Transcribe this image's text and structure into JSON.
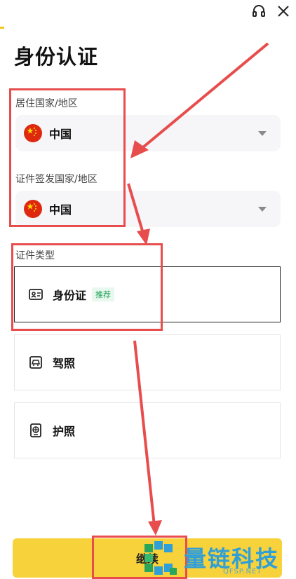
{
  "header": {
    "support_icon": "headset-icon",
    "close_icon": "close-icon"
  },
  "page": {
    "title": "身份认证"
  },
  "residence": {
    "label": "居住国家/地区",
    "value": "中国",
    "flag": "china-flag-icon"
  },
  "issuing": {
    "label": "证件签发国家/地区",
    "value": "中国",
    "flag": "china-flag-icon"
  },
  "doc_type": {
    "label": "证件类型",
    "options": [
      {
        "label": "身份证",
        "badge": "推荐",
        "icon": "id-card-icon",
        "selected": true
      },
      {
        "label": "驾照",
        "icon": "car-license-icon",
        "selected": false
      },
      {
        "label": "护照",
        "icon": "passport-icon",
        "selected": false
      }
    ]
  },
  "footer": {
    "button_label": "继续"
  },
  "watermark": {
    "name": "量链科技",
    "site": "QFSP.NET"
  },
  "colors": {
    "accent": "#f7d23a",
    "annotation": "#e84d4d",
    "badge_green": "#24a35a",
    "watermark_blue": "#2f9fd8"
  }
}
